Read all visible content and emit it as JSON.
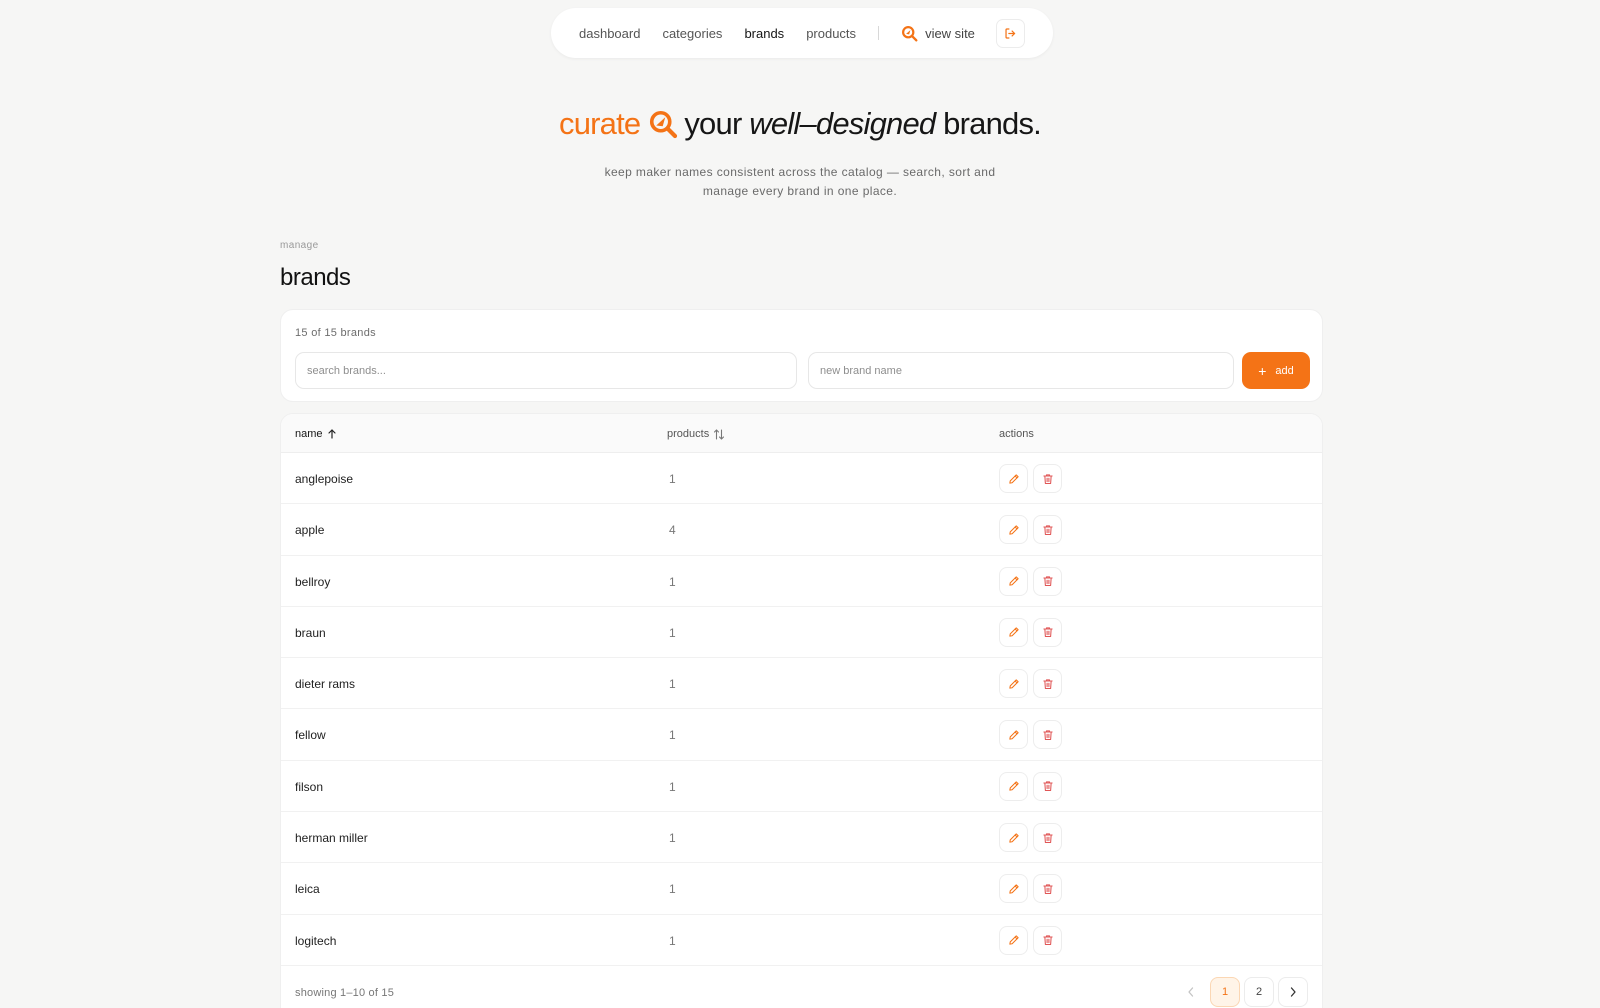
{
  "colors": {
    "accent": "#f47316",
    "danger": "#e05555",
    "background": "#f6f6f5"
  },
  "nav": {
    "links": [
      "dashboard",
      "categories",
      "brands",
      "products"
    ],
    "active": "brands",
    "view_site": "view site",
    "icons": {
      "view_site": "magnifier-logo-icon",
      "logout": "logout-icon"
    }
  },
  "hero": {
    "title_accent": "curate",
    "title_part1": "your ",
    "title_italic": "well–designed",
    "title_part2": " brands.",
    "subtitle": "keep maker names consistent across the catalog — search, sort and manage every brand in one place."
  },
  "page": {
    "eyebrow": "manage",
    "title": "brands"
  },
  "toolbar": {
    "count": "15 of 15 brands",
    "search_placeholder": "search brands...",
    "new_placeholder": "new brand name",
    "add_label": "add"
  },
  "table": {
    "headers": {
      "name": "name",
      "products": "products",
      "actions": "actions"
    },
    "sort": {
      "column": "name",
      "direction": "asc"
    },
    "rows": [
      {
        "name": "anglepoise",
        "products": "1"
      },
      {
        "name": "apple",
        "products": "4"
      },
      {
        "name": "bellroy",
        "products": "1"
      },
      {
        "name": "braun",
        "products": "1"
      },
      {
        "name": "dieter rams",
        "products": "1"
      },
      {
        "name": "fellow",
        "products": "1"
      },
      {
        "name": "filson",
        "products": "1"
      },
      {
        "name": "herman miller",
        "products": "1"
      },
      {
        "name": "leica",
        "products": "1"
      },
      {
        "name": "logitech",
        "products": "1"
      }
    ],
    "row_actions": [
      "pencil-icon",
      "trash-icon"
    ]
  },
  "footer": {
    "showing": "showing 1–10 of 15",
    "pages": [
      "1",
      "2"
    ],
    "current_page": "1"
  }
}
